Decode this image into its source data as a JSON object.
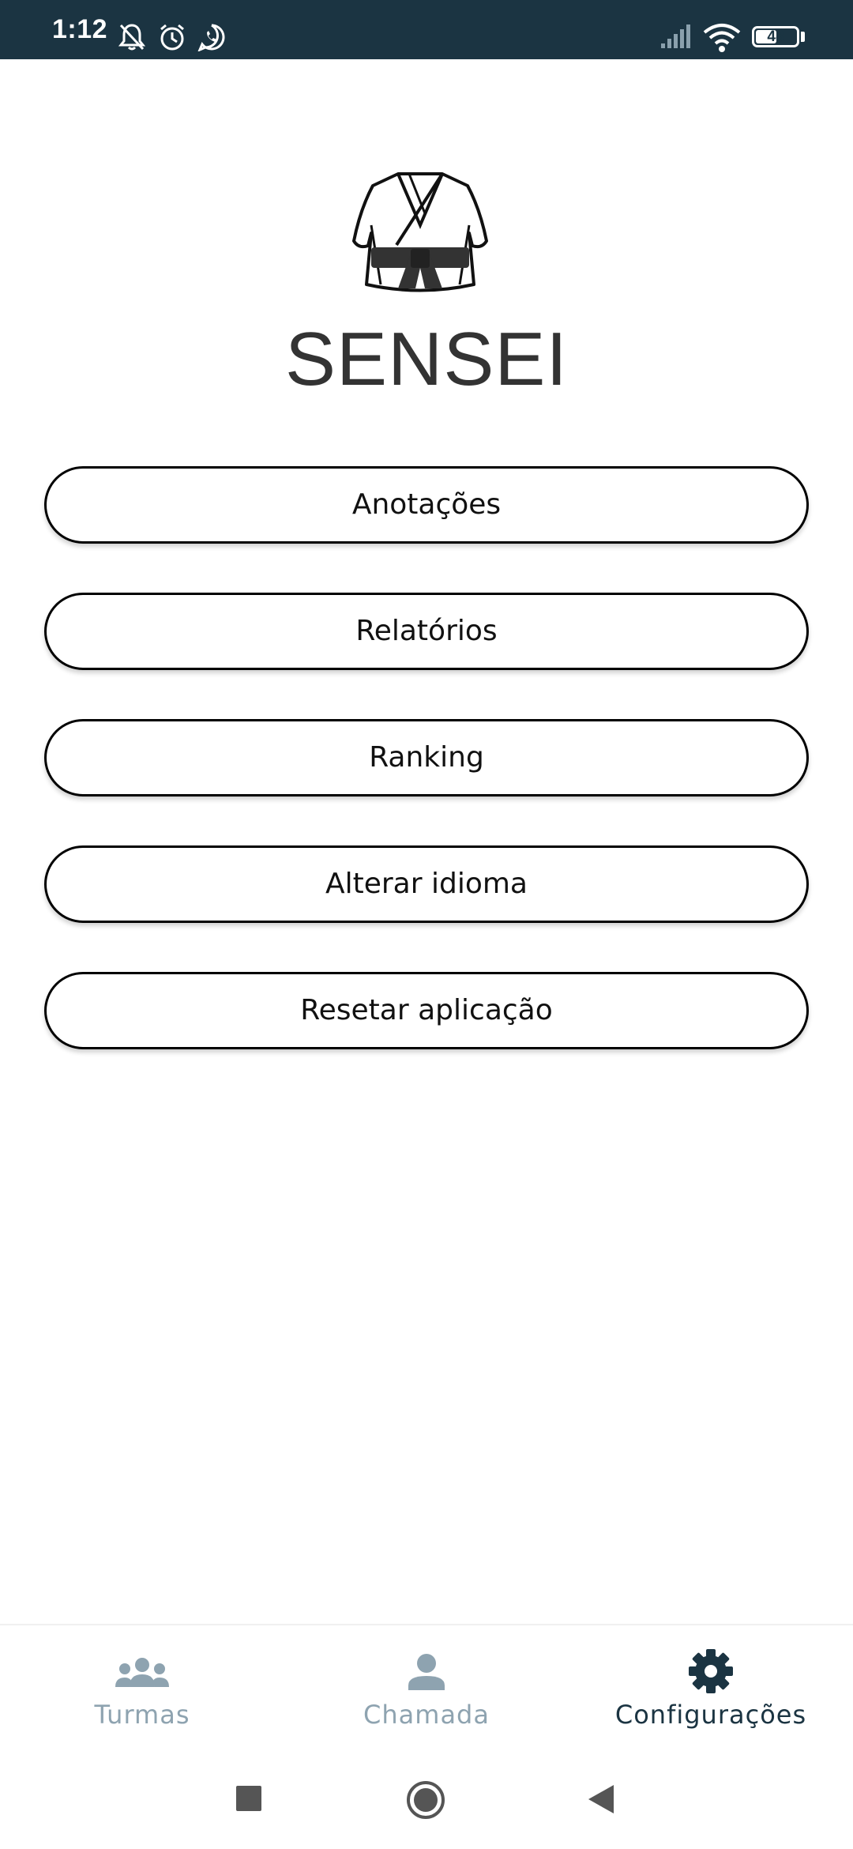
{
  "status_bar": {
    "time": "1:12",
    "battery_level": "48",
    "icons": [
      "bell-off-icon",
      "alarm-icon",
      "whatsapp-icon",
      "signal-icon",
      "wifi-icon",
      "battery-icon"
    ]
  },
  "app": {
    "title": "SENSEI",
    "logo": "gi-black-belt-logo"
  },
  "menu": {
    "items": [
      {
        "label": "Anotações"
      },
      {
        "label": "Relatórios"
      },
      {
        "label": "Ranking"
      },
      {
        "label": "Alterar idioma"
      },
      {
        "label": "Resetar aplicação"
      }
    ]
  },
  "bottom_nav": {
    "items": [
      {
        "label": "Turmas",
        "icon": "group-icon",
        "active": false
      },
      {
        "label": "Chamada",
        "icon": "person-icon",
        "active": false
      },
      {
        "label": "Configurações",
        "icon": "gear-icon",
        "active": true
      }
    ]
  },
  "colors": {
    "status_bar": "#1b3442",
    "nav_active": "#1b3442",
    "nav_inactive": "#8ea3b0",
    "title": "#333333"
  }
}
